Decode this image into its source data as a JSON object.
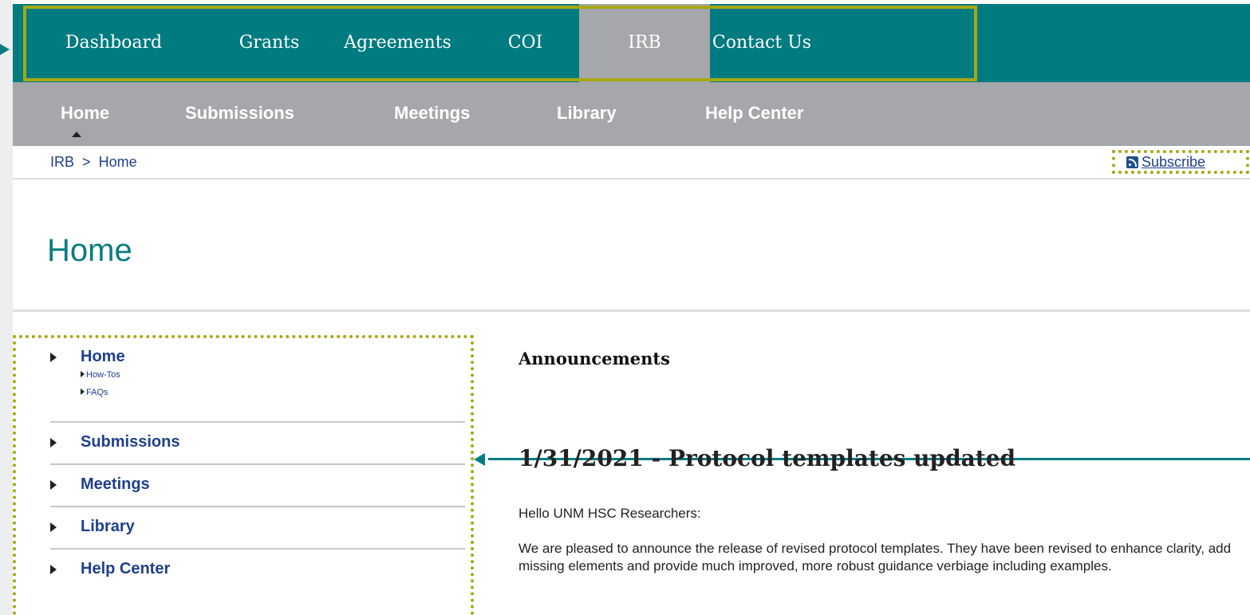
{
  "top_nav": {
    "items": [
      {
        "label": "Dashboard"
      },
      {
        "label": "Grants"
      },
      {
        "label": "Agreements"
      },
      {
        "label": "COI"
      },
      {
        "label": "IRB"
      },
      {
        "label": "Contact Us"
      }
    ],
    "active": "IRB"
  },
  "sub_nav": {
    "items": [
      {
        "label": "Home"
      },
      {
        "label": "Submissions"
      },
      {
        "label": "Meetings"
      },
      {
        "label": "Library"
      },
      {
        "label": "Help Center"
      }
    ],
    "active": "Home"
  },
  "breadcrumb": {
    "root": "IRB",
    "separator": ">",
    "current": "Home"
  },
  "subscribe_label": "Subscribe",
  "page_title": "Home",
  "side_nav": {
    "home": "Home",
    "home_children": [
      "How-Tos",
      "FAQs"
    ],
    "submissions": "Submissions",
    "meetings": "Meetings",
    "library": "Library",
    "help_center": "Help Center"
  },
  "announcements": {
    "heading": "Announcements",
    "title": "1/31/2021 - Protocol templates updated",
    "greeting": "Hello UNM HSC Researchers:",
    "body": "We are pleased to announce the release of revised protocol templates. They have been revised to enhance clarity, add missing elements and provide much improved, more robust guidance verbiage including examples."
  },
  "icons": [
    "rss-icon",
    "caret-up-icon",
    "triangle-right-icon"
  ],
  "colors": {
    "teal": "#007b80",
    "gray_nav": "#a5a7aa",
    "highlight": "#a7a814",
    "link": "#1f3f8a"
  }
}
